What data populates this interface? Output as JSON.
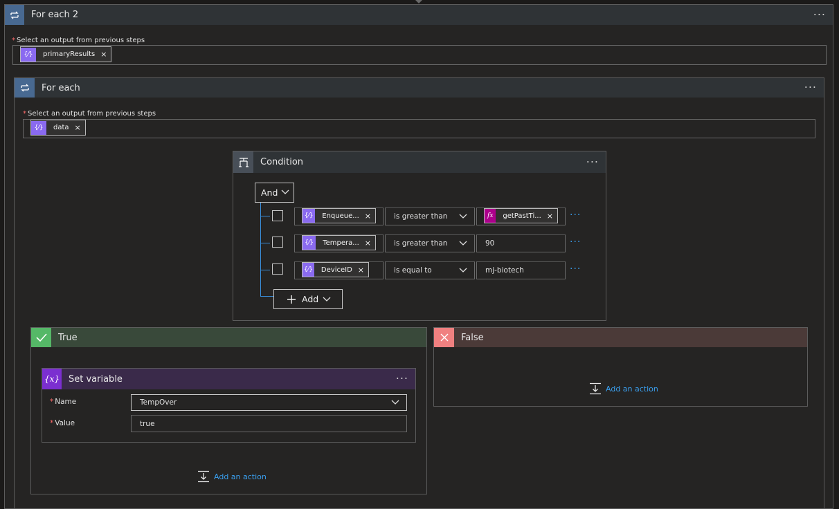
{
  "foreach2": {
    "title": "For each 2",
    "label": "Select an output from previous steps",
    "token": "primaryResults"
  },
  "foreach": {
    "title": "For each",
    "label": "Select an output from previous steps",
    "token": "data"
  },
  "condition": {
    "title": "Condition",
    "group_operator": "And",
    "rows": [
      {
        "left": "Enqueue...",
        "operator": "is greater than",
        "right": "getPastTi...",
        "right_kind": "expression"
      },
      {
        "left": "Tempera...",
        "operator": "is greater than",
        "right": "90",
        "right_kind": "text"
      },
      {
        "left": "DeviceID",
        "operator": "is equal to",
        "right": "mj-biotech",
        "right_kind": "text"
      }
    ],
    "add_label": "Add"
  },
  "true_branch": {
    "title": "True",
    "set_variable": {
      "title": "Set variable",
      "name_label": "Name",
      "name_value": "TempOver",
      "value_label": "Value",
      "value_value": "true"
    },
    "add_action": "Add an action"
  },
  "false_branch": {
    "title": "False",
    "add_action": "Add an action"
  },
  "icons": {
    "loop": "loop-icon",
    "condition": "condition-icon",
    "check": "check-icon",
    "close": "close-icon",
    "variable": "variable-icon",
    "dynamic": "dynamic-content-icon",
    "expression": "fx-icon",
    "add_action": "insert-step-icon"
  },
  "colors": {
    "loop_header": "#2f3336",
    "loop_icon_bg": "#486991",
    "condition_icon_bg": "#484f58",
    "true_header": "#39493a",
    "true_icon": "#55b867",
    "false_header": "#4b3a38",
    "false_icon": "#f08080",
    "variable_header": "#3a2a4a",
    "variable_icon": "#7b2fd0",
    "token": "#8a6af0",
    "expression_token": "#ad008c",
    "link": "#3aa0f0"
  }
}
